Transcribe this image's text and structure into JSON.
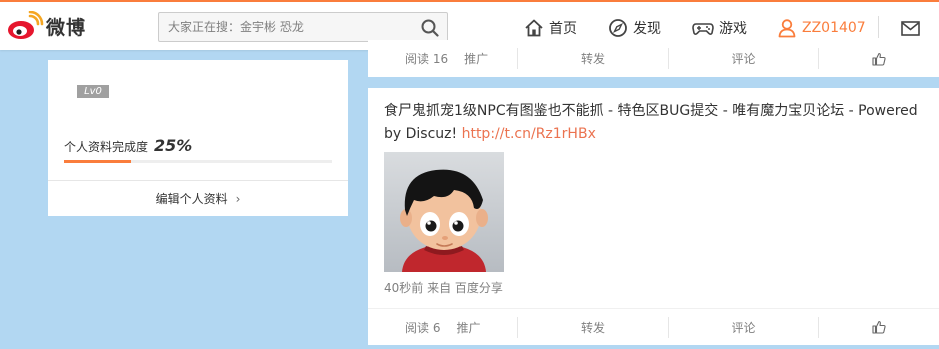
{
  "brand": {
    "logo_text": "微博"
  },
  "search": {
    "placeholder": "大家正在搜：金宇彬 恐龙"
  },
  "nav": {
    "home": "首页",
    "discover": "发现",
    "games": "游戏",
    "user": "ZZ01407"
  },
  "profile": {
    "level": "Lv0",
    "completion_label": "个人资料完成度",
    "completion_value": "25%",
    "completion_fraction": 0.25,
    "edit_label": "编辑个人资料",
    "edit_chevron": "›"
  },
  "posts": [
    {
      "actions": {
        "read_label": "阅读 16",
        "promote": "推广",
        "repost": "转发",
        "comment": "评论"
      }
    },
    {
      "text": "食尸鬼抓宠1级NPC有图鉴也不能抓 - 特色区BUG提交 - 唯有魔力宝贝论坛 - Powered by Discuz!",
      "link": "http://t.cn/Rz1rHBx",
      "meta": "40秒前 来自 百度分享",
      "actions": {
        "read_label": "阅读 6",
        "promote": "推广",
        "repost": "转发",
        "comment": "评论"
      }
    }
  ],
  "colors": {
    "accent": "#fa7d3c",
    "link": "#eb7350",
    "background": "#b2d7f2"
  },
  "icons": [
    "weibo-logo-icon",
    "search-icon",
    "home-icon",
    "compass-icon",
    "gamepad-icon",
    "user-icon",
    "mail-icon",
    "thumbs-up-icon"
  ]
}
